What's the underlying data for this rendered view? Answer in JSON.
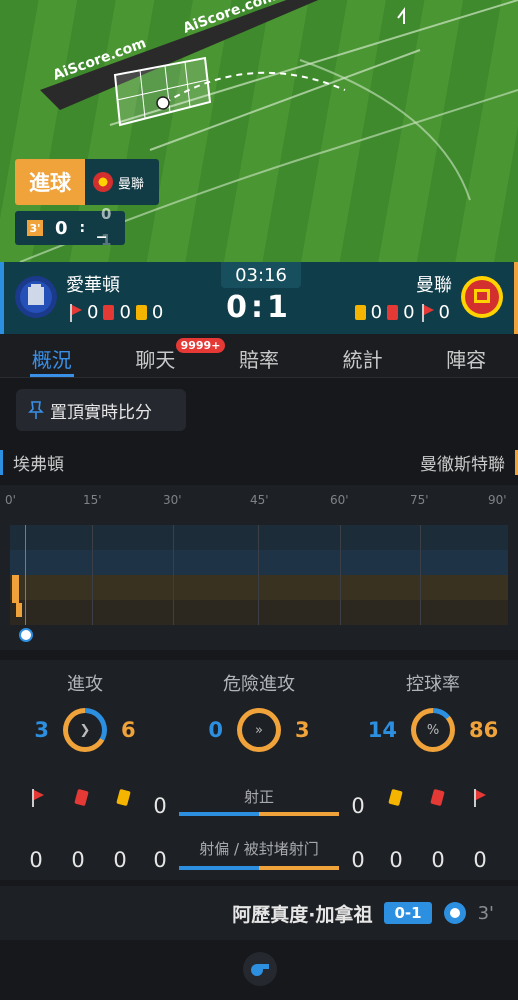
{
  "pitch": {
    "watermark_1": "AiScore.com",
    "watermark_2": "AiScore.com",
    "goal_label": "進球",
    "goal_team": "曼聯",
    "minute_badge": "3'",
    "score_home": "0",
    "score_sep": ":",
    "score_away": "_",
    "score_top": "0",
    "score_bottom": "1"
  },
  "match": {
    "home_team": "愛華頓",
    "away_team": "曼聯",
    "clock": "03:16",
    "score": "0:1",
    "home_stats": {
      "corners": "0",
      "red": "0",
      "yellow": "0"
    },
    "away_stats": {
      "yellow": "0",
      "red": "0",
      "corners": "0"
    }
  },
  "tabs": [
    {
      "label": "概況",
      "active": true
    },
    {
      "label": "聊天",
      "badge": "9999+"
    },
    {
      "label": "賠率"
    },
    {
      "label": "統計"
    },
    {
      "label": "陣容"
    }
  ],
  "pin_button": "置頂實時比分",
  "teams_full": {
    "home": "埃弗頓",
    "away": "曼徹斯特聯"
  },
  "timeline": {
    "ticks": [
      "0'",
      "15'",
      "30'",
      "45'",
      "60'",
      "75'",
      "90'"
    ],
    "goal_minute": 3
  },
  "stats": {
    "attack": {
      "title": "進攻",
      "home": "3",
      "away": "6",
      "icon": "chevron-right-icon"
    },
    "danger": {
      "title": "危險進攻",
      "home": "0",
      "away": "3",
      "icon": "fast-forward-icon"
    },
    "possession": {
      "title": "控球率",
      "home": "14",
      "away": "86",
      "icon": "percent-icon",
      "home_pct": 14
    },
    "shots_on": {
      "label": "射正",
      "home": "0",
      "away": "0"
    },
    "shots_off": {
      "label": "射偏 / 被封堵射门",
      "home": "0",
      "away": "0"
    },
    "home_corners": "0",
    "home_red": "0",
    "home_yellow": "0",
    "away_yellow": "0",
    "away_red": "0",
    "away_corners": "0"
  },
  "event": {
    "player": "阿歷真度·加拿祖",
    "score": "0-1",
    "minute": "3'"
  },
  "colors": {
    "home": "#2d8fe0",
    "away": "#f0a33a",
    "accent": "#3a8fe6"
  }
}
